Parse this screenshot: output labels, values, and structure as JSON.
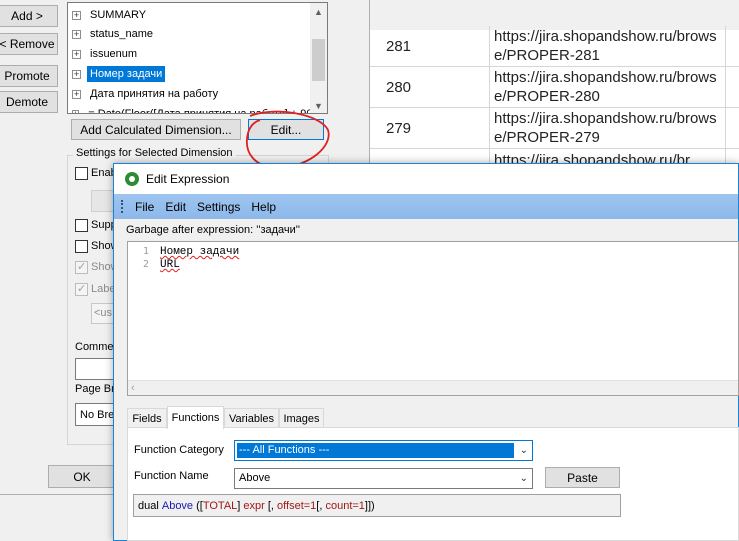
{
  "grid": {
    "rows": [
      {
        "num": "281",
        "url": "https://jira.shopandshow.ru/browse/PROPER-281"
      },
      {
        "num": "280",
        "url": "https://jira.shopandshow.ru/browse/PROPER-280"
      },
      {
        "num": "279",
        "url": "https://jira.shopandshow.ru/browse/PROPER-279"
      },
      {
        "num": "",
        "url": "https://jira.shopandshow.ru/br"
      }
    ]
  },
  "props": {
    "side_buttons": [
      "Add >",
      "< Remove",
      "Promote",
      "Demote"
    ],
    "fields": [
      "SUMMARY",
      "status_name",
      "issuenum",
      "Номер задачи",
      "Дата принятия на работу",
      "= Date(Floor([Дата принятия на работу] + 90"
    ],
    "add_calc_label": "Add Calculated Dimension...",
    "edit_label": "Edit...",
    "settings_title": "Settings for Selected Dimension",
    "checkboxes": [
      "Enab",
      "Supp",
      "Show",
      "Show",
      "Labe"
    ],
    "label_placeholder": "<us",
    "comment_label": "Commen",
    "page_break_label": "Page Bre",
    "page_break_value": "No Brea",
    "ok_label": "OK"
  },
  "dialog": {
    "title": "Edit Expression",
    "menu": [
      "File",
      "Edit",
      "Settings",
      "Help"
    ],
    "status": "Garbage after expression: ''задачи''",
    "code_lines": [
      "Номер задачи",
      "URL"
    ],
    "line_numbers": [
      "1",
      "2"
    ],
    "tabs": [
      "Fields",
      "Functions",
      "Variables",
      "Images"
    ],
    "active_tab": "Functions",
    "function_category_label": "Function Category",
    "function_category_value": "--- All Functions ---",
    "function_name_label": "Function Name",
    "function_name_value": "Above",
    "paste_label": "Paste",
    "syntax": {
      "prefix": "dual ",
      "name": "Above",
      "open": " ([",
      "total": "TOTAL",
      "mid": "] ",
      "expr": "expr",
      "opt1": " [, ",
      "offset": "offset=1",
      "opt2": "[, ",
      "count": "count=1",
      "close": "]])"
    }
  },
  "colors": {
    "accent": "#0078d7",
    "annotation": "#e02020",
    "menubar": "#9fc5f0",
    "syntax_keyword": "#1a1ab4",
    "syntax_param": "#a01818"
  }
}
